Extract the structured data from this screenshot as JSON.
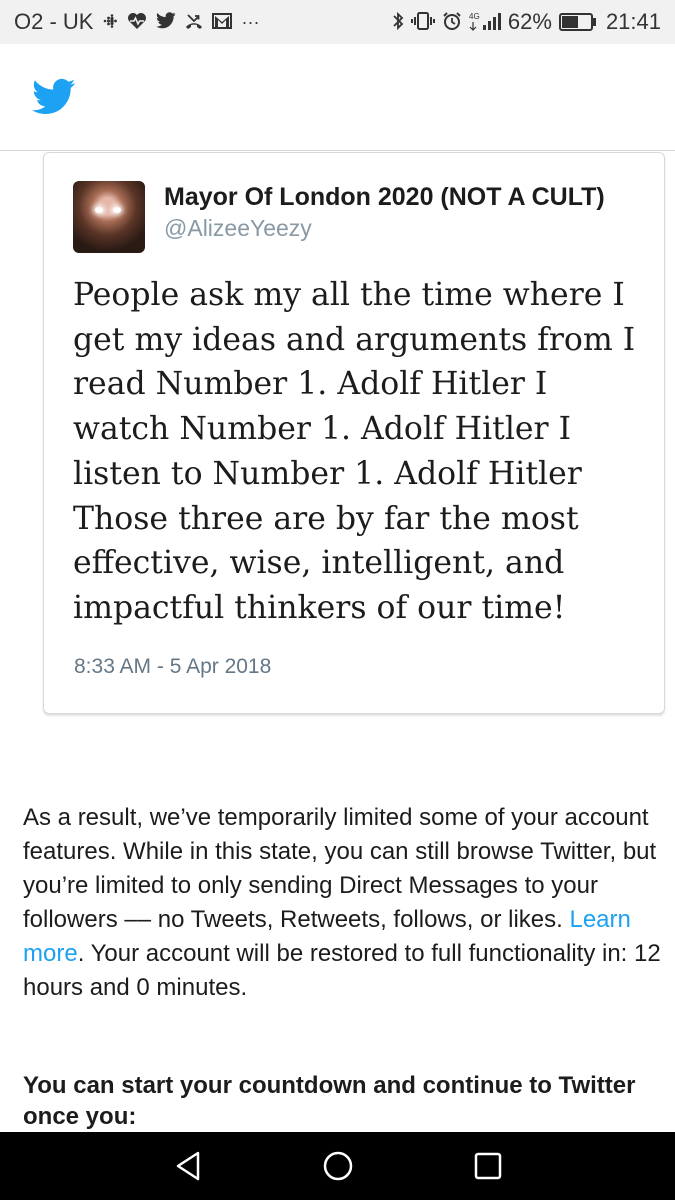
{
  "status_bar": {
    "carrier": "O2 - UK",
    "notification_icons": [
      "fitbit-icon",
      "heart-rate-icon",
      "twitter-icon",
      "missed-call-icon",
      "gmail-icon",
      "more-icon"
    ],
    "more": "···",
    "network": "4G",
    "battery": "62%",
    "battery_level": 0.62,
    "time": "21:41"
  },
  "app": {
    "logo": "twitter-bird-icon",
    "brand_color": "#1da1f2"
  },
  "tweet": {
    "display_name": "Mayor Of London 2020 (NOT A CULT)",
    "handle": "@AlizeeYeezy",
    "text": "People ask my all the time where I get my ideas and arguments from I read Number 1. Adolf Hitler I watch Number 1. Adolf Hitler I listen to Number 1. Adolf Hitler Those three are by far the most effective, wise, intelligent, and impactful thinkers of our time!",
    "timestamp": "8:33 AM - 5 Apr 2018"
  },
  "notice": {
    "text_before_link": "As a result, we’ve temporarily limited some of your account features. While in this state, you can still browse Twitter, but you’re limited to only sending Direct Messages to your followers –– no Tweets, Retweets, follows, or likes. ",
    "link_text": "Learn more",
    "text_after_link": ". Your account will be restored to full functionality in: 12 hours and 0 minutes.",
    "countdown_heading": "You can start your countdown and continue to Twitter once you:"
  },
  "nav_bar": {
    "buttons": [
      "back-icon",
      "home-icon",
      "recents-icon"
    ]
  }
}
